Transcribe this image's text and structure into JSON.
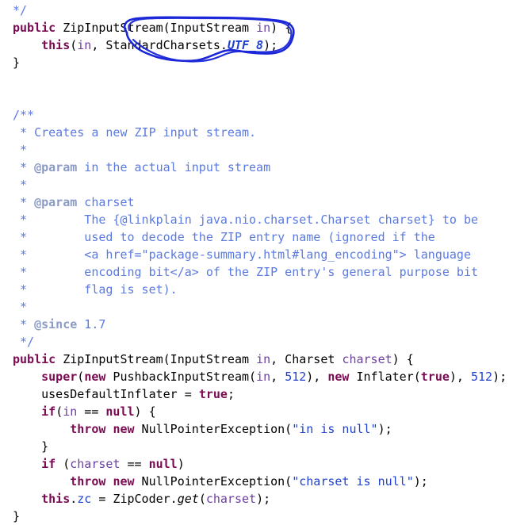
{
  "document": {
    "kind": "java-source-code-screenshot",
    "language": "Java",
    "background_color": "#ffffff",
    "colors": {
      "keyword": "#7a0b52",
      "string": "#2040d0",
      "number": "#2040d0",
      "parameter": "#6b3f9e",
      "field": "#2040d0",
      "javadoc": "#5b7ae0",
      "javadoc_tag": "#8b9bc4",
      "plain": "#000000",
      "annotation": "#1a26d8"
    }
  },
  "annotation": {
    "shape": "hand-drawn-ellipse",
    "color": "#1a26d8",
    "target_text": "StandardCharsets.UTF_8",
    "stroke_width": 2.5
  },
  "code": {
    "lines": [
      {
        "indent": 1,
        "tokens": [
          {
            "t": "doc",
            "s": "*/"
          }
        ]
      },
      {
        "indent": 0,
        "tokens": [
          {
            "t": "kw",
            "s": "public"
          },
          {
            "t": "plain",
            "s": " ZipInputStream(InputStream "
          },
          {
            "t": "param",
            "s": "in"
          },
          {
            "t": "plain",
            "s": ") {"
          }
        ]
      },
      {
        "indent": 0,
        "tokens": [
          {
            "t": "plain",
            "s": "    "
          },
          {
            "t": "kw",
            "s": "this"
          },
          {
            "t": "plain",
            "s": "("
          },
          {
            "t": "param",
            "s": "in"
          },
          {
            "t": "plain",
            "s": ", StandardCharsets."
          },
          {
            "t": "static",
            "s": "UTF_8"
          },
          {
            "t": "plain",
            "s": ");"
          }
        ]
      },
      {
        "indent": 0,
        "tokens": [
          {
            "t": "plain",
            "s": "}"
          }
        ]
      },
      {
        "indent": 0,
        "tokens": []
      },
      {
        "indent": 0,
        "tokens": []
      },
      {
        "indent": 0,
        "tokens": [
          {
            "t": "doc",
            "s": "/**"
          }
        ]
      },
      {
        "indent": 0,
        "tokens": [
          {
            "t": "doc",
            "s": " * Creates a new ZIP input stream."
          }
        ]
      },
      {
        "indent": 0,
        "tokens": [
          {
            "t": "doc",
            "s": " *"
          }
        ]
      },
      {
        "indent": 0,
        "tokens": [
          {
            "t": "doc",
            "s": " * "
          },
          {
            "t": "doctag",
            "s": "@param"
          },
          {
            "t": "doc",
            "s": " in the actual input stream"
          }
        ]
      },
      {
        "indent": 0,
        "tokens": [
          {
            "t": "doc",
            "s": " *"
          }
        ]
      },
      {
        "indent": 0,
        "tokens": [
          {
            "t": "doc",
            "s": " * "
          },
          {
            "t": "doctag",
            "s": "@param"
          },
          {
            "t": "doc",
            "s": " charset"
          }
        ]
      },
      {
        "indent": 0,
        "tokens": [
          {
            "t": "doc",
            "s": " *        The {@linkplain java.nio.charset.Charset charset} to be"
          }
        ]
      },
      {
        "indent": 0,
        "tokens": [
          {
            "t": "doc",
            "s": " *        used to decode the ZIP entry name (ignored if the"
          }
        ]
      },
      {
        "indent": 0,
        "tokens": [
          {
            "t": "doc",
            "s": " *        <a href=\"package-summary.html#lang_encoding\"> language"
          }
        ]
      },
      {
        "indent": 0,
        "tokens": [
          {
            "t": "doc",
            "s": " *        encoding bit</a> of the ZIP entry's general purpose bit"
          }
        ]
      },
      {
        "indent": 0,
        "tokens": [
          {
            "t": "doc",
            "s": " *        flag is set)."
          }
        ]
      },
      {
        "indent": 0,
        "tokens": [
          {
            "t": "doc",
            "s": " *"
          }
        ]
      },
      {
        "indent": 0,
        "tokens": [
          {
            "t": "doc",
            "s": " * "
          },
          {
            "t": "doctag",
            "s": "@since"
          },
          {
            "t": "doc",
            "s": " 1.7"
          }
        ]
      },
      {
        "indent": 0,
        "tokens": [
          {
            "t": "doc",
            "s": " */"
          }
        ]
      },
      {
        "indent": 0,
        "tokens": [
          {
            "t": "kw",
            "s": "public"
          },
          {
            "t": "plain",
            "s": " ZipInputStream(InputStream "
          },
          {
            "t": "param",
            "s": "in"
          },
          {
            "t": "plain",
            "s": ", Charset "
          },
          {
            "t": "param",
            "s": "charset"
          },
          {
            "t": "plain",
            "s": ") {"
          }
        ]
      },
      {
        "indent": 0,
        "tokens": [
          {
            "t": "plain",
            "s": "    "
          },
          {
            "t": "kw",
            "s": "super"
          },
          {
            "t": "plain",
            "s": "("
          },
          {
            "t": "kw",
            "s": "new"
          },
          {
            "t": "plain",
            "s": " PushbackInputStream("
          },
          {
            "t": "param",
            "s": "in"
          },
          {
            "t": "plain",
            "s": ", "
          },
          {
            "t": "num",
            "s": "512"
          },
          {
            "t": "plain",
            "s": "), "
          },
          {
            "t": "kw",
            "s": "new"
          },
          {
            "t": "plain",
            "s": " Inflater("
          },
          {
            "t": "kw",
            "s": "true"
          },
          {
            "t": "plain",
            "s": "), "
          },
          {
            "t": "num",
            "s": "512"
          },
          {
            "t": "plain",
            "s": ");"
          }
        ]
      },
      {
        "indent": 0,
        "tokens": [
          {
            "t": "plain",
            "s": "    usesDefaultInflater = "
          },
          {
            "t": "kw",
            "s": "true"
          },
          {
            "t": "plain",
            "s": ";"
          }
        ]
      },
      {
        "indent": 0,
        "tokens": [
          {
            "t": "plain",
            "s": "    "
          },
          {
            "t": "kw",
            "s": "if"
          },
          {
            "t": "plain",
            "s": "("
          },
          {
            "t": "param",
            "s": "in"
          },
          {
            "t": "plain",
            "s": " == "
          },
          {
            "t": "kw",
            "s": "null"
          },
          {
            "t": "plain",
            "s": ") {"
          }
        ]
      },
      {
        "indent": 0,
        "tokens": [
          {
            "t": "plain",
            "s": "        "
          },
          {
            "t": "kw",
            "s": "throw"
          },
          {
            "t": "plain",
            "s": " "
          },
          {
            "t": "kw",
            "s": "new"
          },
          {
            "t": "plain",
            "s": " NullPointerException("
          },
          {
            "t": "str",
            "s": "\"in is null\""
          },
          {
            "t": "plain",
            "s": ");"
          }
        ]
      },
      {
        "indent": 0,
        "tokens": [
          {
            "t": "plain",
            "s": "    }"
          }
        ]
      },
      {
        "indent": 0,
        "tokens": [
          {
            "t": "plain",
            "s": "    "
          },
          {
            "t": "kw",
            "s": "if"
          },
          {
            "t": "plain",
            "s": " ("
          },
          {
            "t": "param",
            "s": "charset"
          },
          {
            "t": "plain",
            "s": " == "
          },
          {
            "t": "kw",
            "s": "null"
          },
          {
            "t": "plain",
            "s": ")"
          }
        ]
      },
      {
        "indent": 0,
        "tokens": [
          {
            "t": "plain",
            "s": "        "
          },
          {
            "t": "kw",
            "s": "throw"
          },
          {
            "t": "plain",
            "s": " "
          },
          {
            "t": "kw",
            "s": "new"
          },
          {
            "t": "plain",
            "s": " NullPointerException("
          },
          {
            "t": "str",
            "s": "\"charset is null\""
          },
          {
            "t": "plain",
            "s": ");"
          }
        ]
      },
      {
        "indent": 0,
        "tokens": [
          {
            "t": "plain",
            "s": "    "
          },
          {
            "t": "kw",
            "s": "this"
          },
          {
            "t": "plain",
            "s": "."
          },
          {
            "t": "field",
            "s": "zc"
          },
          {
            "t": "plain",
            "s": " = ZipCoder."
          },
          {
            "t": "method-i",
            "s": "get"
          },
          {
            "t": "plain",
            "s": "("
          },
          {
            "t": "param",
            "s": "charset"
          },
          {
            "t": "plain",
            "s": ");"
          }
        ]
      },
      {
        "indent": 0,
        "tokens": [
          {
            "t": "plain",
            "s": "}"
          }
        ]
      }
    ]
  }
}
